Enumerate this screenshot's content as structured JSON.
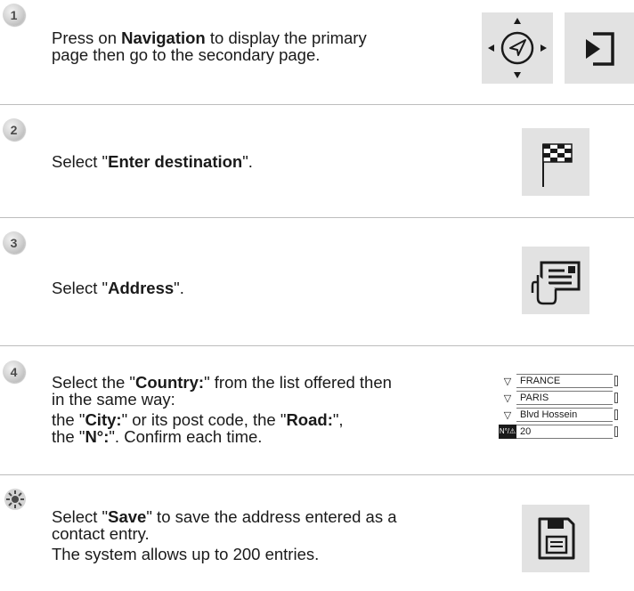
{
  "steps": [
    {
      "badge": "1",
      "lines": [
        [
          {
            "t": "Press on "
          },
          {
            "b": "Navigation"
          },
          {
            "t": " to display the primary"
          }
        ],
        [
          {
            "t": "page then go to the secondary page."
          }
        ]
      ]
    },
    {
      "badge": "2",
      "lines": [
        [
          {
            "t": "Select \""
          },
          {
            "b": "Enter destination"
          },
          {
            "t": "\"."
          }
        ]
      ]
    },
    {
      "badge": "3",
      "lines": [
        [
          {
            "t": "Select \""
          },
          {
            "b": "Address"
          },
          {
            "t": "\"."
          }
        ]
      ]
    },
    {
      "badge": "4",
      "lines": [
        [
          {
            "t": "Select the \""
          },
          {
            "b": "Country:"
          },
          {
            "t": "\" from the list offered then"
          }
        ],
        [
          {
            "t": "in the same way:"
          }
        ],
        [
          {
            "t": "the \""
          },
          {
            "b": "City:"
          },
          {
            "t": "\" or its post code, the \""
          },
          {
            "b": "Road:"
          },
          {
            "t": "\","
          }
        ],
        [
          {
            "t": "the \""
          },
          {
            "b": "N°:"
          },
          {
            "t": "\". Confirm each time."
          }
        ]
      ]
    },
    {
      "badge": "",
      "lines": [
        [
          {
            "t": "Select \""
          },
          {
            "b": "Save"
          },
          {
            "t": "\" to save the address entered as a"
          }
        ],
        [
          {
            "t": "contact entry."
          }
        ],
        [
          {
            "t": "The system allows up to 200 entries."
          }
        ]
      ]
    }
  ],
  "address_list": {
    "country": "FRANCE",
    "city": "PARIS",
    "road": "Blvd Hossein",
    "number_label": "N°/⚠",
    "number": "20"
  },
  "icons": {
    "navigation": "navigation-compass-icon",
    "secondary_page": "secondary-page-icon",
    "destination": "checkered-flag-icon",
    "address": "address-card-hand-icon",
    "tip": "tip-sun-icon",
    "save": "floppy-disk-icon"
  }
}
